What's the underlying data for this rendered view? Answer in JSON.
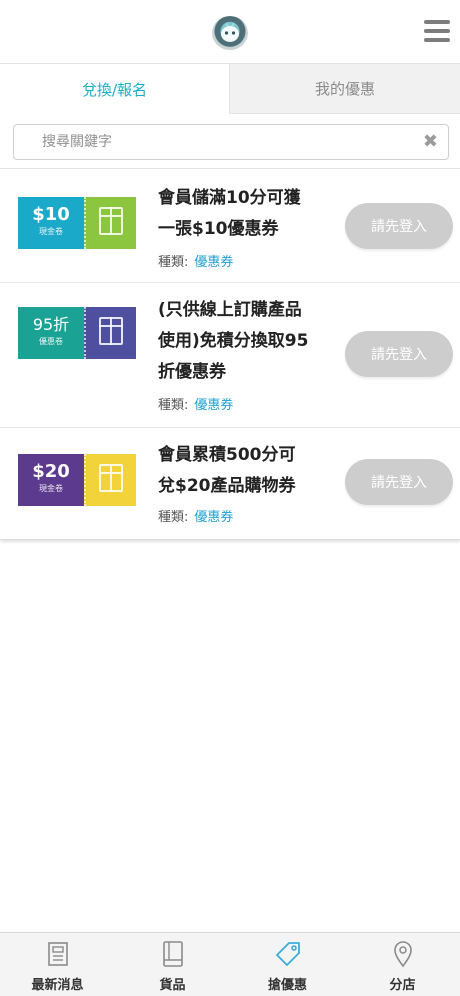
{
  "header": {
    "logo_icon": "mascot-logo-icon",
    "menu_icon": "hamburger-menu-icon"
  },
  "tabs": [
    {
      "label": "兌換/報名",
      "active": true
    },
    {
      "label": "我的優惠",
      "active": false
    }
  ],
  "search": {
    "placeholder": "搜尋關鍵字",
    "value": "",
    "clear_icon": "clear-x-icon"
  },
  "coupons": [
    {
      "image": {
        "amount": "$10",
        "sub": "現金卷",
        "left_color": "#1ba9c9",
        "right_color": "#8cc63f"
      },
      "title_lines": [
        "會員儲滿10分可獲",
        "一張$10優惠券"
      ],
      "type_label": "種類:",
      "type_value": "優惠券",
      "button": "請先登入"
    },
    {
      "image": {
        "amount": "95折",
        "sub": "優惠卷",
        "left_color": "#1aa394",
        "right_color": "#4e4f9e"
      },
      "title_lines": [
        "(只供線上訂購產品",
        "使用)免積分換取95",
        "折優惠券"
      ],
      "type_label": "種類:",
      "type_value": "優惠券",
      "button": "請先登入"
    },
    {
      "image": {
        "amount": "$20",
        "sub": "現金卷",
        "left_color": "#5c3b8e",
        "right_color": "#f2d43a"
      },
      "title_lines": [
        "會員累積500分可",
        "兌$20產品購物券"
      ],
      "type_label": "種類:",
      "type_value": "優惠券",
      "button": "請先登入"
    }
  ],
  "bottom_nav": [
    {
      "label": "最新消息",
      "icon": "newspaper-icon",
      "active": false
    },
    {
      "label": "貨品",
      "icon": "book-icon",
      "active": false
    },
    {
      "label": "搶優惠",
      "icon": "tag-icon",
      "active": true
    },
    {
      "label": "分店",
      "icon": "map-pin-icon",
      "active": false
    }
  ],
  "colors": {
    "accent": "#19aeca",
    "button_disabled": "#cdcdcd",
    "link": "#1e9fd0"
  }
}
